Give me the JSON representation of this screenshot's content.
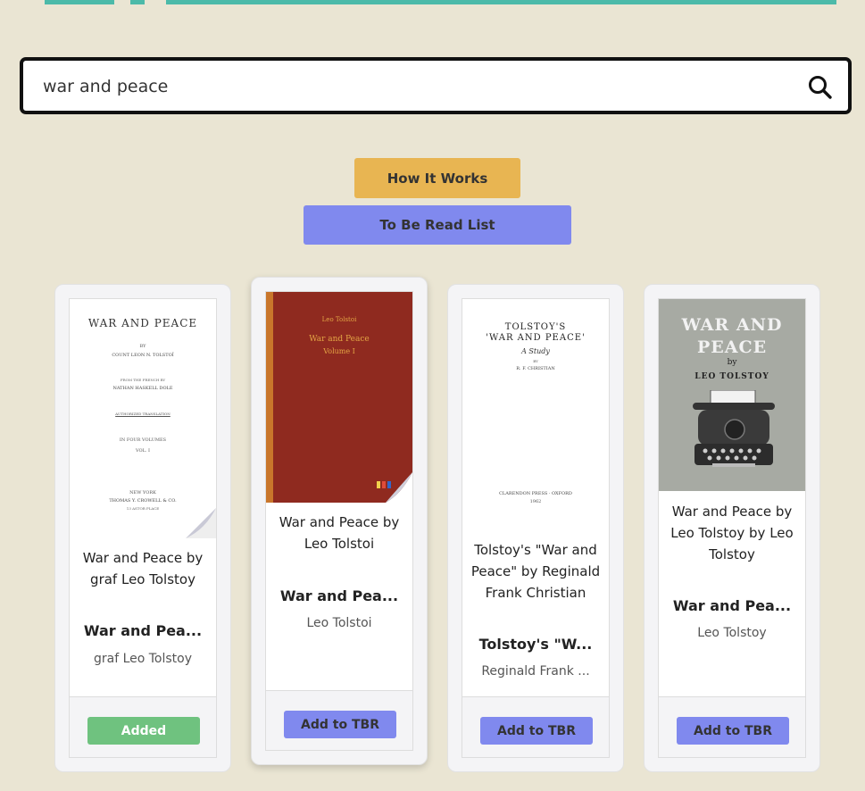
{
  "search": {
    "value": "war and peace",
    "placeholder": ""
  },
  "actions": {
    "how_it_works": "How It Works",
    "to_be_read_list": "To Be Read List"
  },
  "colors": {
    "background": "#eae5d3",
    "accent_teal": "#4cbaa9",
    "yellow": "#e8b552",
    "purple": "#8089ee",
    "green": "#6fc27f"
  },
  "results": [
    {
      "title": "War and Peace by graf Leo Tolstoy",
      "short_title": "War and Pea...",
      "author": "graf Leo Tolstoy",
      "button": "Added",
      "added": true,
      "cover": {
        "title": "WAR AND PEACE",
        "by": "BY",
        "author": "COUNT LEON N. TOLSTOÏ",
        "translated": "FROM THE FRENCH BY",
        "translator": "NATHAN HASKELL DOLE",
        "note": "AUTHORIZED TRANSLATION",
        "volumes": "IN FOUR VOLUMES",
        "volume": "VOL. I",
        "city": "NEW YORK",
        "publisher": "THOMAS Y. CROWELL & CO.",
        "address": "13 ASTOR PLACE"
      }
    },
    {
      "title": "War and Peace by Leo Tolstoi",
      "short_title": "War and Pea...",
      "author": "Leo Tolstoi",
      "button": "Add to TBR",
      "added": false,
      "cover": {
        "author": "Leo Tolstoi",
        "title": "War and Peace",
        "volume": "Volume I"
      }
    },
    {
      "title": "Tolstoy's \"War and Peace\" by Reginald Frank Christian",
      "short_title": "Tolstoy's \"W...",
      "author": "Reginald Frank ...",
      "button": "Add to TBR",
      "added": false,
      "cover": {
        "title1": "TOLSTOY'S",
        "title2": "'WAR AND PEACE'",
        "subtitle": "A Study",
        "by": "BY",
        "author": "R. F. CHRISTIAN",
        "publisher": "CLARENDON PRESS · OXFORD",
        "year": "1962"
      }
    },
    {
      "title": "War and Peace by Leo Tolstoy by Leo Tolstoy",
      "short_title": "War and Pea...",
      "author": "Leo Tolstoy",
      "button": "Add to TBR",
      "added": false,
      "cover": {
        "title1": "WAR AND",
        "title2": "PEACE",
        "by": "by",
        "author": "LEO TOLSTOY"
      }
    }
  ]
}
